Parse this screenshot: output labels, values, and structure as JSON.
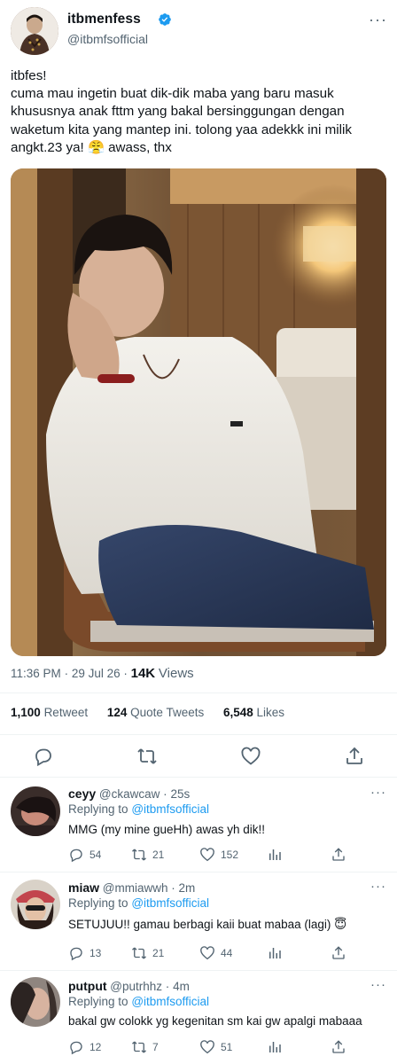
{
  "author": {
    "name": "itbmenfess",
    "handle": "@itbmfsofficial",
    "verified": true
  },
  "tweet": {
    "text": "itbfes!\ncuma mau ingetin buat dik-dik maba yang baru masuk khususnya anak fttm yang bakal bersinggungan dengan waketum kita yang mantep ini. tolong yaa adekkk ini milik angkt.23 ya! 😤 awass, thx",
    "time": "11:36 PM",
    "date": "29 Jul 26",
    "views_count": "14K",
    "views_label": "Views"
  },
  "stats": {
    "retweets_count": "1,100",
    "retweets_label": "Retweet",
    "quotes_count": "124",
    "quotes_label": "Quote Tweets",
    "likes_count": "6,548",
    "likes_label": "Likes"
  },
  "icons": [
    "reply-icon",
    "retweet-icon",
    "like-icon",
    "share-icon",
    "verified-badge-icon",
    "more-icon",
    "views-icon"
  ],
  "colors": {
    "accent": "#1d9bf0",
    "muted": "#536471",
    "divider": "#eff3f4"
  },
  "replies": [
    {
      "name": "ceyy",
      "handle": "@ckawcaw",
      "time": "25s",
      "replying_prefix": "Replying to",
      "replying_to": "@itbmfsofficial",
      "text": "MMG (my mine gueHh) awas yh dik!!",
      "reply_count": "54",
      "retweet_count": "21",
      "like_count": "152"
    },
    {
      "name": "miaw",
      "handle": "@mmiawwh",
      "time": "2m",
      "replying_prefix": "Replying to",
      "replying_to": "@itbmfsofficial",
      "text": "SETUJUU!! gamau berbagi kaii buat mabaa (lagi) 😇",
      "reply_count": "13",
      "retweet_count": "21",
      "like_count": "44"
    },
    {
      "name": "putput",
      "handle": "@putrhhz",
      "time": "4m",
      "replying_prefix": "Replying to",
      "replying_to": "@itbmfsofficial",
      "text": "bakal gw colokk yg kegenitan sm kai gw apalgi mabaaa",
      "reply_count": "12",
      "retweet_count": "7",
      "like_count": "51"
    }
  ]
}
